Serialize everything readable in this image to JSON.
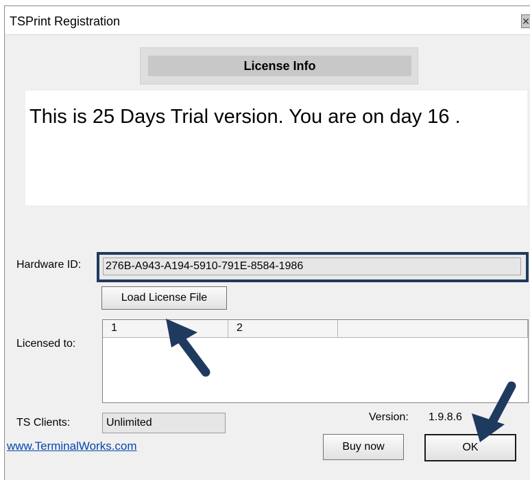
{
  "window": {
    "title": "TSPrint Registration",
    "close_glyph": "✕"
  },
  "license": {
    "header": "License Info",
    "trial_message": "This is 25 Days Trial version. You are on day 16 ."
  },
  "hardware": {
    "label": "Hardware ID:",
    "value": "276B-A943-A194-5910-791E-8584-1986"
  },
  "buttons": {
    "load_license": "Load License File",
    "buy_now": "Buy now",
    "ok": "OK"
  },
  "licensed": {
    "label": "Licensed to:",
    "columns": [
      "1",
      "2",
      ""
    ]
  },
  "ts_clients": {
    "label": "TS Clients:",
    "value": "Unlimited"
  },
  "version": {
    "label": "Version:",
    "value": "1.9.8.6"
  },
  "footer": {
    "link": "www.TerminalWorks.com"
  },
  "colors": {
    "highlight_frame": "#1f3a5f",
    "arrow": "#1f3a5f",
    "link": "#0645ad"
  },
  "icons": [
    "close-icon",
    "pointer-arrow-icon"
  ]
}
